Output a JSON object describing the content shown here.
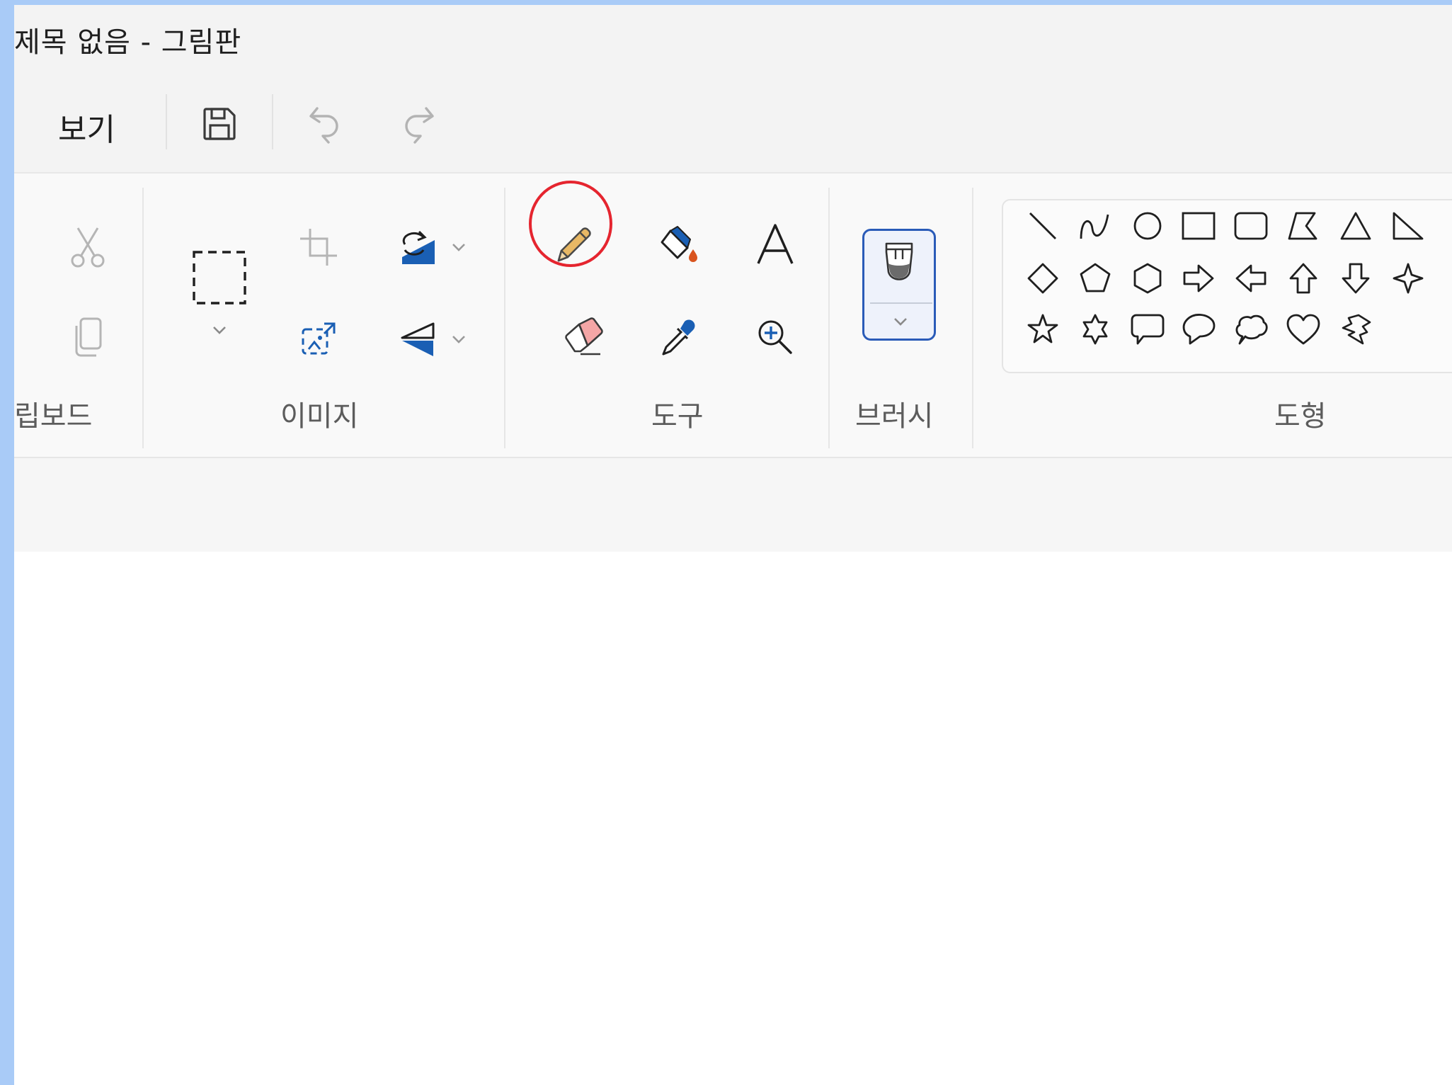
{
  "window": {
    "title": "제목 없음 - 그림판"
  },
  "menu": {
    "view_label": "보기"
  },
  "quick_access": {
    "save_icon": "save-icon",
    "undo_icon": "undo-icon",
    "redo_icon": "redo-icon"
  },
  "ribbon": {
    "groups": [
      {
        "id": "clipboard",
        "label": "립보드",
        "tools": [
          "cut-icon",
          "copy-icon"
        ]
      },
      {
        "id": "image",
        "label": "이미지",
        "tools": [
          "select-icon",
          "crop-icon",
          "resize-icon",
          "rotate-icon",
          "flip-icon"
        ]
      },
      {
        "id": "tools",
        "label": "도구",
        "tools": [
          "pencil-icon",
          "fill-icon",
          "text-icon",
          "eraser-icon",
          "color-picker-icon",
          "magnifier-icon"
        ]
      },
      {
        "id": "brushes",
        "label": "브러시",
        "tools": [
          "brush-icon"
        ]
      },
      {
        "id": "shapes",
        "label": "도형",
        "tools": [
          "line",
          "curve",
          "oval",
          "rectangle",
          "rounded-rectangle",
          "polygon",
          "triangle",
          "right-triangle",
          "diamond",
          "pentagon",
          "hexagon",
          "right-arrow",
          "left-arrow",
          "up-arrow",
          "down-arrow",
          "four-point-star",
          "five-point-star",
          "six-point-star",
          "rounded-callout",
          "oval-callout",
          "cloud-callout",
          "heart",
          "lightning"
        ]
      }
    ],
    "selected_tool": "pencil-icon"
  },
  "colors": {
    "accent": "#2a5bb8",
    "highlight": "#e5252f",
    "pencil": "#e8b865",
    "eraser": "#f4a6a6",
    "fill_blue": "#1a5fb4",
    "fill_drop": "#d9541e"
  }
}
